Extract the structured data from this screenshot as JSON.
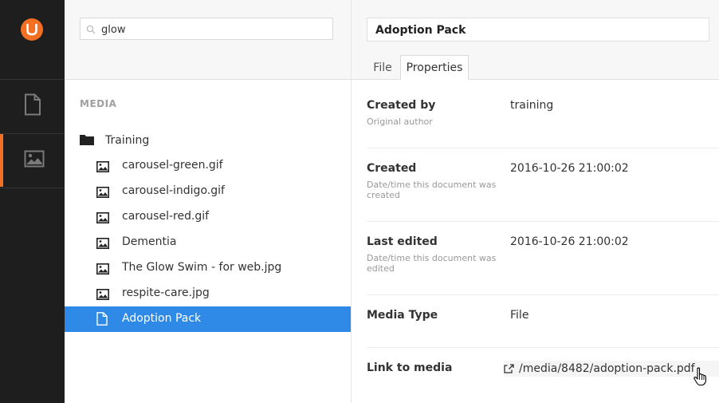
{
  "sidebar": {
    "logo_icon": "umbraco-logo-icon",
    "sections": [
      {
        "name": "content",
        "icon": "document-icon",
        "active": false
      },
      {
        "name": "media",
        "icon": "image-icon",
        "active": true
      }
    ],
    "accent_color": "#f36f21"
  },
  "tree": {
    "search": {
      "value": "glow",
      "placeholder": ""
    },
    "section_label": "MEDIA",
    "folder": {
      "label": "Training",
      "icon": "folder-icon"
    },
    "items": [
      {
        "label": "carousel-green.gif",
        "icon": "image-icon"
      },
      {
        "label": "carousel-indigo.gif",
        "icon": "image-icon"
      },
      {
        "label": "carousel-red.gif",
        "icon": "image-icon"
      },
      {
        "label": "Dementia",
        "icon": "image-icon"
      },
      {
        "label": "The Glow Swim - for web.jpg",
        "icon": "image-icon"
      },
      {
        "label": "respite-care.jpg",
        "icon": "image-icon"
      },
      {
        "label": "Adoption Pack",
        "icon": "document-icon",
        "selected": true
      }
    ],
    "selected_color": "#2e8ae6"
  },
  "editor": {
    "name": "Adoption Pack",
    "tabs": [
      {
        "label": "File",
        "active": false
      },
      {
        "label": "Properties",
        "active": true
      }
    ],
    "properties": [
      {
        "label": "Created by",
        "description": "Original author",
        "value": "training"
      },
      {
        "label": "Created",
        "description": "Date/time this document was created",
        "value": "2016-10-26 21:00:02"
      },
      {
        "label": "Last edited",
        "description": "Date/time this document was edited",
        "value": "2016-10-26 21:00:02"
      },
      {
        "label": "Media Type",
        "description": "",
        "value": "File"
      },
      {
        "label": "Link to media",
        "description": "",
        "value": "/media/8482/adoption-pack.pdf",
        "icon": "external-link-icon"
      }
    ]
  }
}
